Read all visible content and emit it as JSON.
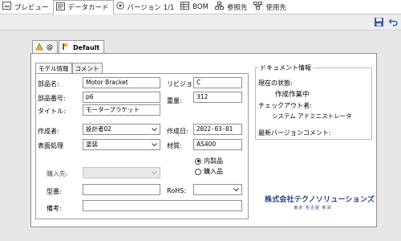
{
  "tabs": [
    {
      "label": "プレビュー",
      "icon": "preview-icon"
    },
    {
      "label": "データカード",
      "icon": "datacard-icon"
    },
    {
      "label": "バージョン 1/1",
      "icon": "version-icon"
    },
    {
      "label": "BOM",
      "icon": "bom-icon"
    },
    {
      "label": "参照先",
      "icon": "references-icon"
    },
    {
      "label": "使用先",
      "icon": "where-used-icon"
    }
  ],
  "config_tabs": [
    {
      "label": "@",
      "icon": "config-icon"
    },
    {
      "label": "Default",
      "icon": "config-icon"
    }
  ],
  "inner_tabs": [
    "モデル情報",
    "コメント"
  ],
  "form": {
    "part_name_label": "部品名:",
    "part_name_value": "Motor Bracket",
    "part_number_label": "部品番号:",
    "part_number_value": "p6",
    "title_label": "タイトル:",
    "title_value": "モーターブラケット",
    "revision_label": "リビジョン:",
    "revision_value": "C",
    "weight_label": "重量:",
    "weight_value": "312",
    "author_label": "作成者:",
    "author_value": "設計者02",
    "created_label": "作成日:",
    "created_value": "2022-03-01",
    "surface_label": "表面処理",
    "surface_value": "塗装",
    "material_label": "材質:",
    "material_value": "AS400",
    "radio_inhouse": "内製品",
    "radio_purchased": "購入品",
    "vendor_label": "購入先:",
    "vendor_value": "",
    "model_no_label": "型番:",
    "model_no_value": "",
    "rohs_label": "RoHS:",
    "rohs_value": "",
    "remarks_label": "備考:",
    "remarks_value": ""
  },
  "doc_info": {
    "title": "ドキュメント情報",
    "state_label": "現在の状態:",
    "state_value": "作成作業中",
    "checkout_label": "チェックアウト者:",
    "checkout_value": "システム アドミニストレータ",
    "latest_comment_label": "最新バージョンコメント:"
  },
  "logo": {
    "name": "株式会社テクノソリューションズ",
    "sub": "東京 名古屋 新潟"
  },
  "colors": {
    "logo_blue": "#1f3f86",
    "content_bg": "#e6e6e6",
    "toolbar_bg": "#ededed"
  }
}
